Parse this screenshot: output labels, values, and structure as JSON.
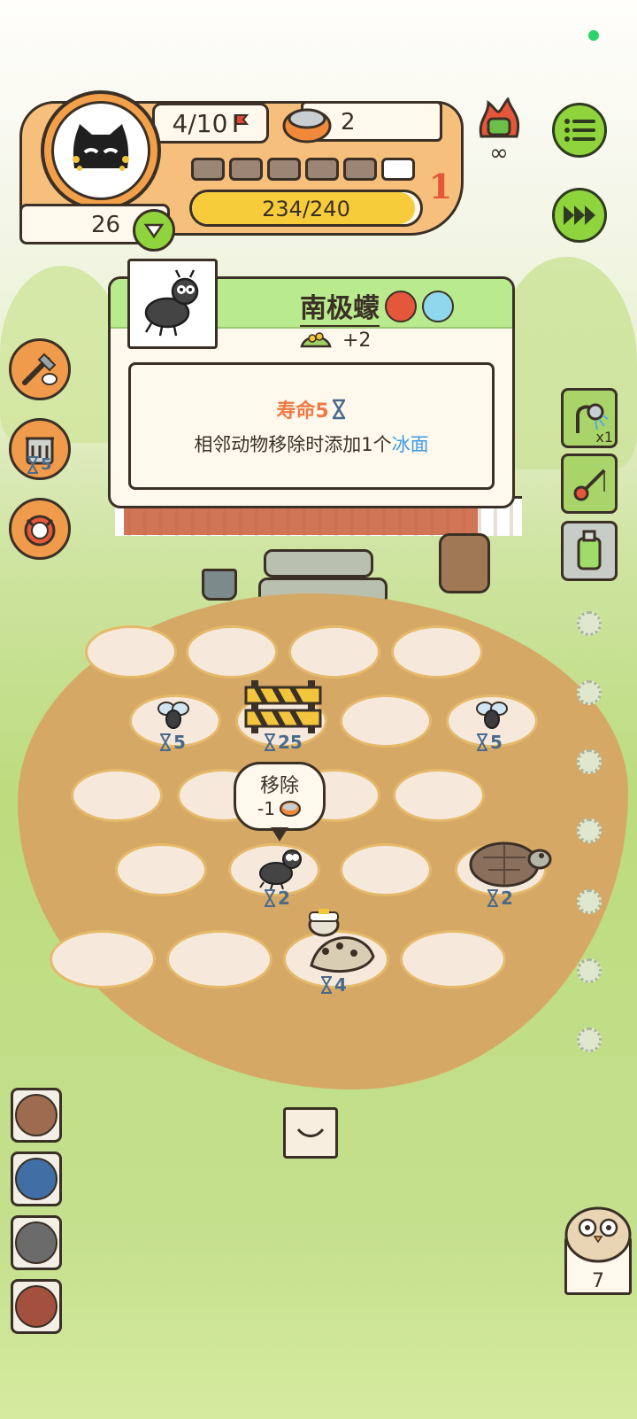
{
  "status": {
    "dot_color": "#2bd36a"
  },
  "player": {
    "avatar_icon": "black-cat-icon",
    "level": "26",
    "progress_count": "4/10",
    "stage_segments_filled": 5,
    "stage_segments_total": 6,
    "stage_number": "1",
    "hp": "234/240",
    "hp_fraction": 0.975
  },
  "currency": {
    "icon": "food-can-icon",
    "amount": "2"
  },
  "top_right": {
    "infinite_label": "∞",
    "menu_icon": "menu-list-icon",
    "speed_icon": "fast-forward-icon"
  },
  "tooltip": {
    "name": "南极蠓",
    "icon": "midge-icon",
    "food_bonus": "+2",
    "lifespan_label": "寿命5",
    "desc_prefix": "相邻动物移除时添加1个",
    "desc_highlight": "冰面",
    "colors": {
      "lifespan": "#ef7a45",
      "highlight": "#3e9ce6",
      "header": "#b9ea8d"
    }
  },
  "board": {
    "remove_bubble": {
      "title": "移除",
      "cost": "-1"
    },
    "units": [
      {
        "name": "fly-left",
        "counter": "5"
      },
      {
        "name": "barrier",
        "counter": "25"
      },
      {
        "name": "fly-right",
        "counter": "5"
      },
      {
        "name": "midge",
        "counter": "2"
      },
      {
        "name": "turtle",
        "counter": "2"
      },
      {
        "name": "penguin-snake",
        "counter": "4"
      }
    ]
  },
  "left_skills": [
    {
      "name": "shovel-skill",
      "badge": ""
    },
    {
      "name": "trash-skill",
      "badge": "5"
    },
    {
      "name": "lucky-cat-skill",
      "badge": ""
    }
  ],
  "right_items": [
    {
      "name": "shower-item",
      "badge": "x1"
    },
    {
      "name": "fishing-rod-item",
      "badge": ""
    },
    {
      "name": "pesticide-item",
      "badge": ""
    }
  ],
  "bottom_slots": [
    {
      "name": "brown-slot",
      "color": "#9c6b50"
    },
    {
      "name": "blue-slot",
      "color": "#3f6fa4"
    },
    {
      "name": "gray-slot",
      "color": "#6b6b6b"
    },
    {
      "name": "red-slot",
      "color": "#a4503f"
    }
  ],
  "deck": {
    "count": "7"
  }
}
